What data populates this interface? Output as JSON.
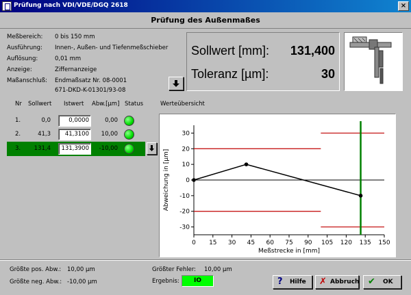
{
  "window": {
    "title": "Prüfung nach VDI/VDE/DGQ 2618",
    "close_label": "×"
  },
  "heading": "Prüfung des Außenmaßes",
  "info": [
    {
      "label": "Meßbereich:",
      "value": "0 bis 150 mm"
    },
    {
      "label": "Ausführung:",
      "value": "Innen-, Außen- und Tiefenmeßschieber"
    },
    {
      "label": "Auflösung:",
      "value": "0,01 mm"
    },
    {
      "label": "Anzeige:",
      "value": "Ziffernanzeige"
    },
    {
      "label": "Maßanschluß:",
      "value": "Endmaßsatz Nr. 08-0001"
    }
  ],
  "info_extra": "671-DKD-K-01301/93-08",
  "sollwert": {
    "label": "Sollwert [mm]:",
    "value": "131,400"
  },
  "toleranz": {
    "label": "Toleranz [µm]:",
    "value": "30"
  },
  "table": {
    "headers": {
      "nr": "Nr",
      "sollwert": "Sollwert",
      "istwert": "Istwert",
      "abw": "Abw.[µm]",
      "status": "Status",
      "overview": "Werteübersicht"
    },
    "rows": [
      {
        "nr": "1.",
        "sollwert": "0,0",
        "istwert": "0,0000",
        "abw": "0,00"
      },
      {
        "nr": "2.",
        "sollwert": "41,3",
        "istwert": "41,3100",
        "abw": "10,00"
      },
      {
        "nr": "3.",
        "sollwert": "131,4",
        "istwert": "131,3900",
        "abw": "-10,00"
      }
    ]
  },
  "chart_data": {
    "type": "line",
    "xlabel": "Meßstrecke in [mm]",
    "ylabel": "Abweichung in [µm]",
    "xlim": [
      0,
      150
    ],
    "ylim": [
      -35,
      35
    ],
    "xticks": [
      0,
      15,
      30,
      45,
      60,
      75,
      90,
      105,
      120,
      135,
      150
    ],
    "yticks": [
      30,
      20,
      10,
      0,
      -10,
      -20,
      -30
    ],
    "series": [
      {
        "x": [
          0,
          41.3,
          131.4
        ],
        "y": [
          0,
          10,
          -10
        ],
        "color": "#000000"
      }
    ],
    "tolerance_lines": [
      {
        "y": 20,
        "x_from": 0,
        "x_to": 100,
        "color": "#c00000"
      },
      {
        "y": -20,
        "x_from": 0,
        "x_to": 100,
        "color": "#c00000"
      },
      {
        "y": 30,
        "x_from": 100,
        "x_to": 150,
        "color": "#c00000"
      },
      {
        "y": -30,
        "x_from": 100,
        "x_to": 150,
        "color": "#c00000"
      }
    ],
    "current_marker": {
      "x": 131.4,
      "color": "#008000"
    }
  },
  "summary": {
    "max_pos_label": "Größte pos. Abw.:",
    "max_pos_value": "10,00 µm",
    "max_neg_label": "Größte neg. Abw.:",
    "max_neg_value": "-10,00 µm",
    "max_err_label": "Größter Fehler:",
    "max_err_value": "10,00 µm",
    "result_label": "Ergebnis:",
    "result_value": "IO"
  },
  "buttons": {
    "help": "Hilfe",
    "cancel": "Abbruch",
    "ok": "OK"
  },
  "colors": {
    "titlebar": "#000080",
    "ok_green": "#00ff00",
    "highlight_row": "#008000",
    "tolerance": "#c00000"
  }
}
